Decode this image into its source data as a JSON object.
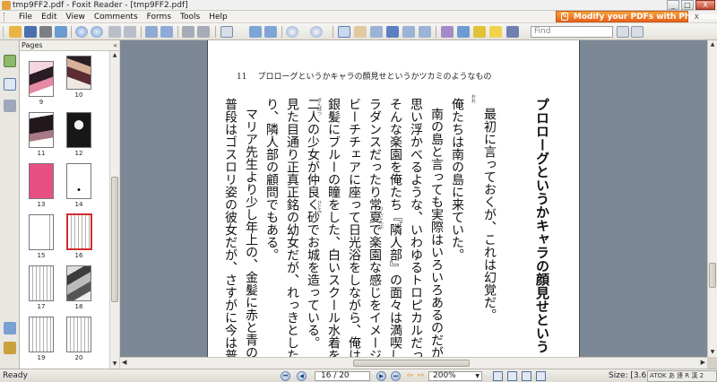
{
  "window": {
    "title": "tmp9FF2.pdf - Foxit Reader - [tmp9FF2.pdf]",
    "minimize": "_",
    "maximize": "□",
    "close": "X"
  },
  "menu": {
    "items": [
      "File",
      "Edit",
      "View",
      "Comments",
      "Forms",
      "Tools",
      "Help"
    ],
    "promo": "Modify your PDFs with Phantom",
    "doc_close": "x"
  },
  "toolbar": {
    "find_placeholder": "Find"
  },
  "pages_panel": {
    "title": "Pages",
    "collapse": "«",
    "thumbnails": [
      {
        "num": "9"
      },
      {
        "num": "10"
      },
      {
        "num": "11"
      },
      {
        "num": "12"
      },
      {
        "num": "13"
      },
      {
        "num": "14"
      },
      {
        "num": "15"
      },
      {
        "num": "16"
      },
      {
        "num": "17"
      },
      {
        "num": "18"
      },
      {
        "num": "19"
      },
      {
        "num": "20"
      }
    ]
  },
  "document": {
    "page_number": "11",
    "running_header": "プロローグというかキャラの顔見せというかツカミのようなもの",
    "heading": "プロローグというかキャラの顔見せという",
    "columns": [
      "最初に言っておくが、これは幻覚だ。",
      "俺たちは南の島に来ていた。",
      "南の島と言っても実際はいろいろあるのだが、",
      "思い浮かべるような、いわゆるトロピカルだった",
      "そんな楽園を俺たち『隣人部』の面々は満喫し",
      "ラダンスだったり常夏で楽園な感じをイメージし",
      "ビーチチェアに座って日光浴をしながら、俺は",
      "銀髪にブルーの瞳をした、白いスクール水着を",
      "二人の少女が仲良く砂でお城を造っている。",
      "見た目通り正真正銘の幼女だが、れっきとした",
      "り、隣人部の顧問でもある。",
      "マリア先生より少し年上の、金髪に赤と青のオ",
      "普段はゴスロリ姿の彼女だが、さすがに今は普"
    ],
    "ruby": {
      "ore": "おれ",
      "rinjinbu": "りんじんぶ",
      "ginpatsu": "ぎんぱつ",
      "hitomi": "ひとみ"
    }
  },
  "statusbar": {
    "status": "Ready",
    "page_indicator": "16 / 20",
    "zoom": "200%",
    "size": "Size: [3.6",
    "ime": "ATOK  あ 連 R  漢 2"
  }
}
